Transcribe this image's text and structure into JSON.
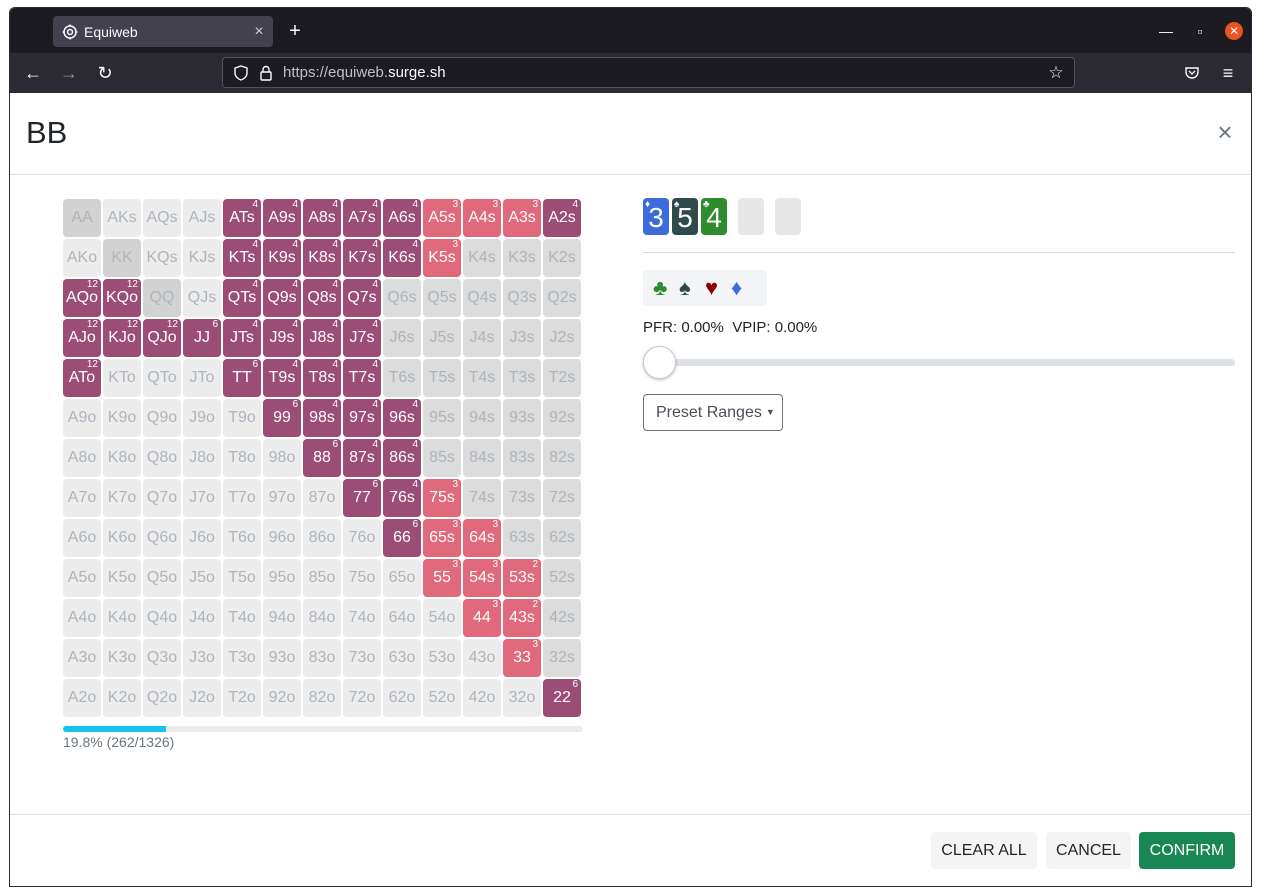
{
  "browser": {
    "tab_title": "Equiweb",
    "url_prefix": "https://equiweb.",
    "url_domain": "surge.sh",
    "new_tab_label": "+",
    "tab_close_label": "×"
  },
  "modal": {
    "title": "BB",
    "close_label": "×"
  },
  "range_grid": {
    "rows": [
      [
        {
          "t": "AA",
          "c": "pair",
          "n": ""
        },
        {
          "t": "AKs",
          "c": "",
          "n": ""
        },
        {
          "t": "AQs",
          "c": "",
          "n": ""
        },
        {
          "t": "AJs",
          "c": "",
          "n": ""
        },
        {
          "t": "ATs",
          "c": "sel",
          "n": "4"
        },
        {
          "t": "A9s",
          "c": "sel",
          "n": "4"
        },
        {
          "t": "A8s",
          "c": "sel",
          "n": "4"
        },
        {
          "t": "A7s",
          "c": "sel",
          "n": "4"
        },
        {
          "t": "A6s",
          "c": "sel",
          "n": "4"
        },
        {
          "t": "A5s",
          "c": "alt",
          "n": "3"
        },
        {
          "t": "A4s",
          "c": "alt",
          "n": "3"
        },
        {
          "t": "A3s",
          "c": "alt",
          "n": "3"
        },
        {
          "t": "A2s",
          "c": "sel",
          "n": "4"
        }
      ],
      [
        {
          "t": "AKo",
          "c": "",
          "n": ""
        },
        {
          "t": "KK",
          "c": "pair",
          "n": ""
        },
        {
          "t": "KQs",
          "c": "",
          "n": ""
        },
        {
          "t": "KJs",
          "c": "",
          "n": ""
        },
        {
          "t": "KTs",
          "c": "sel",
          "n": "4"
        },
        {
          "t": "K9s",
          "c": "sel",
          "n": "4"
        },
        {
          "t": "K8s",
          "c": "sel",
          "n": "4"
        },
        {
          "t": "K7s",
          "c": "sel",
          "n": "4"
        },
        {
          "t": "K6s",
          "c": "sel",
          "n": "4"
        },
        {
          "t": "K5s",
          "c": "alt",
          "n": "3"
        },
        {
          "t": "K4s",
          "c": "dk",
          "n": ""
        },
        {
          "t": "K3s",
          "c": "dk",
          "n": ""
        },
        {
          "t": "K2s",
          "c": "dk",
          "n": ""
        }
      ],
      [
        {
          "t": "AQo",
          "c": "sel",
          "n": "12"
        },
        {
          "t": "KQo",
          "c": "sel",
          "n": "12"
        },
        {
          "t": "QQ",
          "c": "pair",
          "n": ""
        },
        {
          "t": "QJs",
          "c": "",
          "n": ""
        },
        {
          "t": "QTs",
          "c": "sel",
          "n": "4"
        },
        {
          "t": "Q9s",
          "c": "sel",
          "n": "4"
        },
        {
          "t": "Q8s",
          "c": "sel",
          "n": "4"
        },
        {
          "t": "Q7s",
          "c": "sel",
          "n": "4"
        },
        {
          "t": "Q6s",
          "c": "dk",
          "n": ""
        },
        {
          "t": "Q5s",
          "c": "dk",
          "n": ""
        },
        {
          "t": "Q4s",
          "c": "dk",
          "n": ""
        },
        {
          "t": "Q3s",
          "c": "dk",
          "n": ""
        },
        {
          "t": "Q2s",
          "c": "dk",
          "n": ""
        }
      ],
      [
        {
          "t": "AJo",
          "c": "sel",
          "n": "12"
        },
        {
          "t": "KJo",
          "c": "sel",
          "n": "12"
        },
        {
          "t": "QJo",
          "c": "sel",
          "n": "12"
        },
        {
          "t": "JJ",
          "c": "sel",
          "n": "6"
        },
        {
          "t": "JTs",
          "c": "sel",
          "n": "4"
        },
        {
          "t": "J9s",
          "c": "sel",
          "n": "4"
        },
        {
          "t": "J8s",
          "c": "sel",
          "n": "4"
        },
        {
          "t": "J7s",
          "c": "sel",
          "n": "4"
        },
        {
          "t": "J6s",
          "c": "dk",
          "n": ""
        },
        {
          "t": "J5s",
          "c": "dk",
          "n": ""
        },
        {
          "t": "J4s",
          "c": "dk",
          "n": ""
        },
        {
          "t": "J3s",
          "c": "dk",
          "n": ""
        },
        {
          "t": "J2s",
          "c": "dk",
          "n": ""
        }
      ],
      [
        {
          "t": "ATo",
          "c": "sel",
          "n": "12"
        },
        {
          "t": "KTo",
          "c": "",
          "n": ""
        },
        {
          "t": "QTo",
          "c": "",
          "n": ""
        },
        {
          "t": "JTo",
          "c": "",
          "n": ""
        },
        {
          "t": "TT",
          "c": "sel",
          "n": "6"
        },
        {
          "t": "T9s",
          "c": "sel",
          "n": "4"
        },
        {
          "t": "T8s",
          "c": "sel",
          "n": "4"
        },
        {
          "t": "T7s",
          "c": "sel",
          "n": "4"
        },
        {
          "t": "T6s",
          "c": "dk",
          "n": ""
        },
        {
          "t": "T5s",
          "c": "dk",
          "n": ""
        },
        {
          "t": "T4s",
          "c": "dk",
          "n": ""
        },
        {
          "t": "T3s",
          "c": "dk",
          "n": ""
        },
        {
          "t": "T2s",
          "c": "dk",
          "n": ""
        }
      ],
      [
        {
          "t": "A9o",
          "c": "",
          "n": ""
        },
        {
          "t": "K9o",
          "c": "",
          "n": ""
        },
        {
          "t": "Q9o",
          "c": "",
          "n": ""
        },
        {
          "t": "J9o",
          "c": "",
          "n": ""
        },
        {
          "t": "T9o",
          "c": "",
          "n": ""
        },
        {
          "t": "99",
          "c": "sel",
          "n": "6"
        },
        {
          "t": "98s",
          "c": "sel",
          "n": "4"
        },
        {
          "t": "97s",
          "c": "sel",
          "n": "4"
        },
        {
          "t": "96s",
          "c": "sel",
          "n": "4"
        },
        {
          "t": "95s",
          "c": "dk",
          "n": ""
        },
        {
          "t": "94s",
          "c": "dk",
          "n": ""
        },
        {
          "t": "93s",
          "c": "dk",
          "n": ""
        },
        {
          "t": "92s",
          "c": "dk",
          "n": ""
        }
      ],
      [
        {
          "t": "A8o",
          "c": "",
          "n": ""
        },
        {
          "t": "K8o",
          "c": "",
          "n": ""
        },
        {
          "t": "Q8o",
          "c": "",
          "n": ""
        },
        {
          "t": "J8o",
          "c": "",
          "n": ""
        },
        {
          "t": "T8o",
          "c": "",
          "n": ""
        },
        {
          "t": "98o",
          "c": "",
          "n": ""
        },
        {
          "t": "88",
          "c": "sel",
          "n": "6"
        },
        {
          "t": "87s",
          "c": "sel",
          "n": "4"
        },
        {
          "t": "86s",
          "c": "sel",
          "n": "4"
        },
        {
          "t": "85s",
          "c": "dk",
          "n": ""
        },
        {
          "t": "84s",
          "c": "dk",
          "n": ""
        },
        {
          "t": "83s",
          "c": "dk",
          "n": ""
        },
        {
          "t": "82s",
          "c": "dk",
          "n": ""
        }
      ],
      [
        {
          "t": "A7o",
          "c": "",
          "n": ""
        },
        {
          "t": "K7o",
          "c": "",
          "n": ""
        },
        {
          "t": "Q7o",
          "c": "",
          "n": ""
        },
        {
          "t": "J7o",
          "c": "",
          "n": ""
        },
        {
          "t": "T7o",
          "c": "",
          "n": ""
        },
        {
          "t": "97o",
          "c": "",
          "n": ""
        },
        {
          "t": "87o",
          "c": "",
          "n": ""
        },
        {
          "t": "77",
          "c": "sel",
          "n": "6"
        },
        {
          "t": "76s",
          "c": "sel",
          "n": "4"
        },
        {
          "t": "75s",
          "c": "alt",
          "n": "3"
        },
        {
          "t": "74s",
          "c": "dk",
          "n": ""
        },
        {
          "t": "73s",
          "c": "dk",
          "n": ""
        },
        {
          "t": "72s",
          "c": "dk",
          "n": ""
        }
      ],
      [
        {
          "t": "A6o",
          "c": "",
          "n": ""
        },
        {
          "t": "K6o",
          "c": "",
          "n": ""
        },
        {
          "t": "Q6o",
          "c": "",
          "n": ""
        },
        {
          "t": "J6o",
          "c": "",
          "n": ""
        },
        {
          "t": "T6o",
          "c": "",
          "n": ""
        },
        {
          "t": "96o",
          "c": "",
          "n": ""
        },
        {
          "t": "86o",
          "c": "",
          "n": ""
        },
        {
          "t": "76o",
          "c": "",
          "n": ""
        },
        {
          "t": "66",
          "c": "sel",
          "n": "6"
        },
        {
          "t": "65s",
          "c": "alt",
          "n": "3"
        },
        {
          "t": "64s",
          "c": "alt",
          "n": "3"
        },
        {
          "t": "63s",
          "c": "dk",
          "n": ""
        },
        {
          "t": "62s",
          "c": "dk",
          "n": ""
        }
      ],
      [
        {
          "t": "A5o",
          "c": "",
          "n": ""
        },
        {
          "t": "K5o",
          "c": "",
          "n": ""
        },
        {
          "t": "Q5o",
          "c": "",
          "n": ""
        },
        {
          "t": "J5o",
          "c": "",
          "n": ""
        },
        {
          "t": "T5o",
          "c": "",
          "n": ""
        },
        {
          "t": "95o",
          "c": "",
          "n": ""
        },
        {
          "t": "85o",
          "c": "",
          "n": ""
        },
        {
          "t": "75o",
          "c": "",
          "n": ""
        },
        {
          "t": "65o",
          "c": "",
          "n": ""
        },
        {
          "t": "55",
          "c": "alt",
          "n": "3"
        },
        {
          "t": "54s",
          "c": "alt",
          "n": "3"
        },
        {
          "t": "53s",
          "c": "alt",
          "n": "2"
        },
        {
          "t": "52s",
          "c": "dk",
          "n": ""
        }
      ],
      [
        {
          "t": "A4o",
          "c": "",
          "n": ""
        },
        {
          "t": "K4o",
          "c": "",
          "n": ""
        },
        {
          "t": "Q4o",
          "c": "",
          "n": ""
        },
        {
          "t": "J4o",
          "c": "",
          "n": ""
        },
        {
          "t": "T4o",
          "c": "",
          "n": ""
        },
        {
          "t": "94o",
          "c": "",
          "n": ""
        },
        {
          "t": "84o",
          "c": "",
          "n": ""
        },
        {
          "t": "74o",
          "c": "",
          "n": ""
        },
        {
          "t": "64o",
          "c": "",
          "n": ""
        },
        {
          "t": "54o",
          "c": "",
          "n": ""
        },
        {
          "t": "44",
          "c": "alt",
          "n": "3"
        },
        {
          "t": "43s",
          "c": "alt",
          "n": "2"
        },
        {
          "t": "42s",
          "c": "dk",
          "n": ""
        }
      ],
      [
        {
          "t": "A3o",
          "c": "",
          "n": ""
        },
        {
          "t": "K3o",
          "c": "",
          "n": ""
        },
        {
          "t": "Q3o",
          "c": "",
          "n": ""
        },
        {
          "t": "J3o",
          "c": "",
          "n": ""
        },
        {
          "t": "T3o",
          "c": "",
          "n": ""
        },
        {
          "t": "93o",
          "c": "",
          "n": ""
        },
        {
          "t": "83o",
          "c": "",
          "n": ""
        },
        {
          "t": "73o",
          "c": "",
          "n": ""
        },
        {
          "t": "63o",
          "c": "",
          "n": ""
        },
        {
          "t": "53o",
          "c": "",
          "n": ""
        },
        {
          "t": "43o",
          "c": "",
          "n": ""
        },
        {
          "t": "33",
          "c": "alt",
          "n": "3"
        },
        {
          "t": "32s",
          "c": "dk",
          "n": ""
        }
      ],
      [
        {
          "t": "A2o",
          "c": "",
          "n": ""
        },
        {
          "t": "K2o",
          "c": "",
          "n": ""
        },
        {
          "t": "Q2o",
          "c": "",
          "n": ""
        },
        {
          "t": "J2o",
          "c": "",
          "n": ""
        },
        {
          "t": "T2o",
          "c": "",
          "n": ""
        },
        {
          "t": "92o",
          "c": "",
          "n": ""
        },
        {
          "t": "82o",
          "c": "",
          "n": ""
        },
        {
          "t": "72o",
          "c": "",
          "n": ""
        },
        {
          "t": "62o",
          "c": "",
          "n": ""
        },
        {
          "t": "52o",
          "c": "",
          "n": ""
        },
        {
          "t": "42o",
          "c": "",
          "n": ""
        },
        {
          "t": "32o",
          "c": "",
          "n": ""
        },
        {
          "t": "22",
          "c": "sel",
          "n": "6"
        }
      ]
    ]
  },
  "progress": {
    "fraction": 0.198,
    "label": "19.8% (262/1326)"
  },
  "board": {
    "cards": [
      {
        "rank": "3",
        "suit": "♦",
        "color": "#3b6bdc"
      },
      {
        "rank": "5",
        "suit": "♠",
        "color": "#2f4a4a"
      },
      {
        "rank": "4",
        "suit": "♣",
        "color": "#2e8b2e"
      }
    ],
    "empty_slots": 2
  },
  "suit_filter": [
    {
      "symbol": "♣",
      "name": "clubs",
      "color": "#2e8b2e"
    },
    {
      "symbol": "♠",
      "name": "spades",
      "color": "#2f4a4a"
    },
    {
      "symbol": "♥",
      "name": "hearts",
      "color": "#8b0000"
    },
    {
      "symbol": "♦",
      "name": "diamonds",
      "color": "#3b6bdc"
    }
  ],
  "stats": {
    "pfr": "PFR: 0.00%",
    "vpip": "VPIP: 0.00%"
  },
  "slider": {
    "value": 0
  },
  "preset_ranges": {
    "label": "Preset Ranges"
  },
  "footer": {
    "clear_all": "CLEAR ALL",
    "cancel": "CANCEL",
    "confirm": "CONFIRM"
  },
  "colors": {
    "selected": "#9b4d75",
    "alt_selected": "#e0697b",
    "confirm": "#198754",
    "progress": "#17c3ea"
  }
}
